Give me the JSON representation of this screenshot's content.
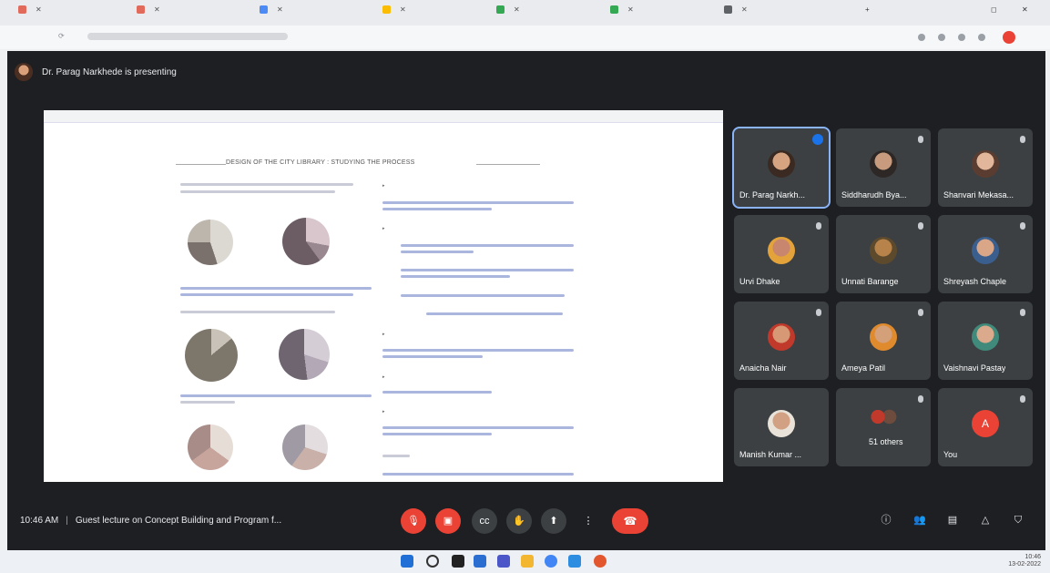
{
  "meeting": {
    "presenter_text": "Dr. Parag Narkhede is presenting",
    "time": "10:46 AM",
    "title": "Guest lecture on Concept Building and Program f..."
  },
  "slide": {
    "title": "DESIGN OF THE CITY LIBRARY : STUDYING THE PROCESS"
  },
  "participants": [
    {
      "name": "Dr. Parag Narkh...",
      "speaking": true
    },
    {
      "name": "Siddharudh Bya..."
    },
    {
      "name": "Shanvari Mekasa..."
    },
    {
      "name": "Urvi Dhake"
    },
    {
      "name": "Unnati Barange"
    },
    {
      "name": "Shreyash Chaple"
    },
    {
      "name": "Anaicha Nair"
    },
    {
      "name": "Ameya Patil"
    },
    {
      "name": "Vaishnavi Pastay"
    },
    {
      "name": "Manish Kumar ..."
    },
    {
      "name": "51 others"
    },
    {
      "name": "You",
      "initial": "A"
    }
  ],
  "taskbar": {
    "date": "13-02-2022",
    "time": "10:46"
  },
  "colors": {
    "meet_bg": "#1e1f22",
    "tile_bg": "#3c4043",
    "accent": "#8ab4f8",
    "danger": "#ea4335"
  }
}
